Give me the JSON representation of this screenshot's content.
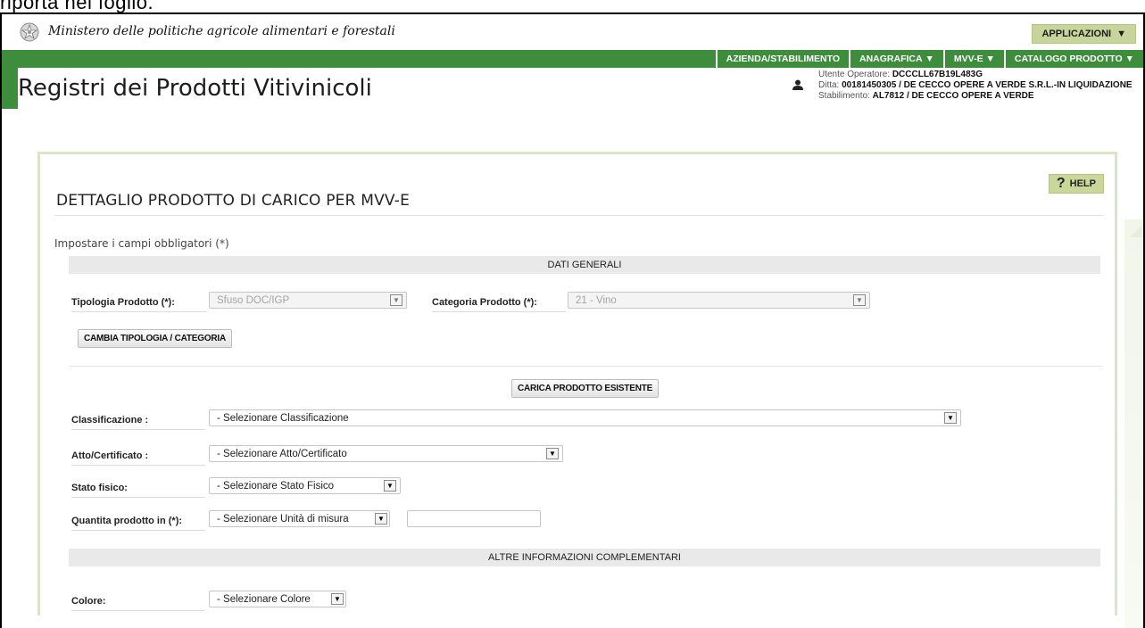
{
  "caption": "riporta nel foglio.",
  "ministry": {
    "name": "Ministero delle politiche agricole alimentari e forestali",
    "applications_label": "APPLICAZIONI"
  },
  "nav": [
    {
      "label": "AZIENDA/STABILIMENTO",
      "arrow": ""
    },
    {
      "label": "ANAGRAFICA",
      "arrow": "▼"
    },
    {
      "label": "MVV-E",
      "arrow": "▼"
    },
    {
      "label": "CATALOGO PRODOTTO",
      "arrow": "▼"
    }
  ],
  "app_title": "Registri dei Prodotti Vitivinicoli",
  "user": {
    "operator_label": "Utente Operatore:",
    "operator_value": "DCCCLL67B19L483G",
    "company_label": "Ditta:",
    "company_value": "00181450305 / DE CECCO OPERE A VERDE S.R.L.-IN LIQUIDAZIONE",
    "plant_label": "Stabilimento:",
    "plant_value": "AL7812 / DE CECCO OPERE A VERDE"
  },
  "help_label": "HELP",
  "page_title": "DETTAGLIO PRODOTTO DI CARICO PER MVV-E",
  "required_note": "Impostare i campi obbligatori (*)",
  "sections": {
    "general": "DATI GENERALI",
    "other": "ALTRE INFORMAZIONI COMPLEMENTARI"
  },
  "form": {
    "tipologia_label": "Tipologia Prodotto (*):",
    "tipologia_value": "Sfuso DOC/IGP",
    "categoria_label": "Categoria Prodotto (*):",
    "categoria_value": "21 - Vino",
    "change_button": "CAMBIA TIPOLOGIA / CATEGORIA",
    "load_button": "CARICA PRODOTTO ESISTENTE",
    "classificazione_label": "Classificazione :",
    "classificazione_value": "- Selezionare Classificazione",
    "atto_label": "Atto/Certificato :",
    "atto_value": "- Selezionare Atto/Certificato",
    "stato_label": "Stato fisico:",
    "stato_value": "- Selezionare Stato Fisico",
    "quantita_label": "Quantita prodotto in  (*):",
    "quantita_unit_value": "- Selezionare Unità di misura",
    "quantita_value": "",
    "colore_label": "Colore:",
    "colore_value": "- Selezionare Colore"
  }
}
